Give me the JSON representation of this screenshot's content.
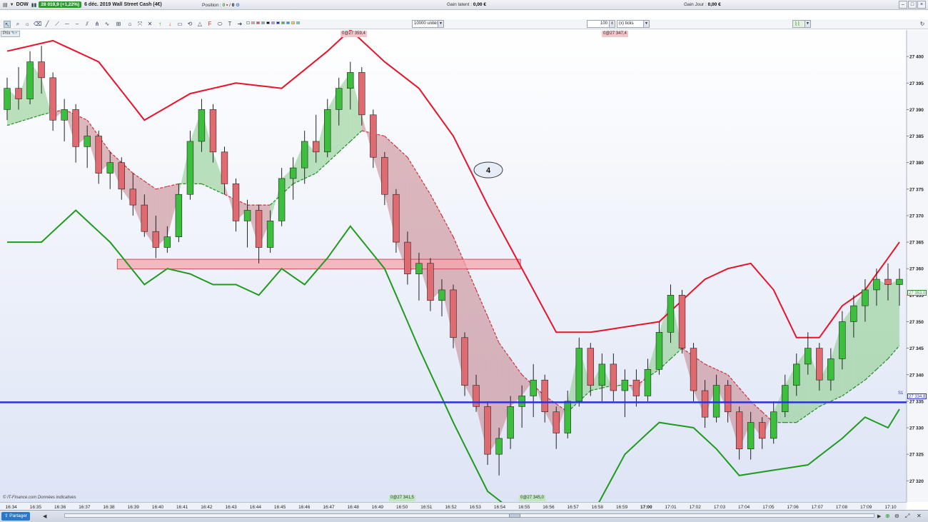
{
  "title_bar": {
    "instrument": "DOW",
    "price_badge": "28 019,9 (+1,22%)",
    "title": "6 déc. 2019 Wall Street Cash (4€)",
    "position_label": "Position :",
    "position_value": "0",
    "position_value2": "0",
    "gain_latent_label": "Gain latent :",
    "gain_latent_value": "0,00 €",
    "gain_jour_label": "Gain Jour :",
    "gain_jour_value": "0,00 €"
  },
  "toolbar": {
    "quantity_value": "10000 unités",
    "ticks_value": "100",
    "ticks_unit": "(x) ticks"
  },
  "labels": {
    "prix_tab": "Prix",
    "copyright": "© IT-Finance.com Données indicatives",
    "share_button": "Partager",
    "annotation": "4",
    "marker_top_left": "0@27 359,4",
    "marker_top_right": "0@27 347,4",
    "marker_bottom_left": "0@27 341,5",
    "marker_bottom_right": "0@27 345,0",
    "current_price": "27 353,0",
    "blue_line_price": "27 334,8",
    "blue_line_tag": "S1"
  },
  "colors": {
    "bull": "#3cbf3c",
    "bear": "#e06a70",
    "upper_band": "#e8132a",
    "lower_band": "#1f9a1f",
    "support_line": "#2832d8"
  },
  "chart_data": {
    "type": "candlestick",
    "ylim": [
      27316,
      27405
    ],
    "y_ticks": [
      27400,
      27395,
      27390,
      27385,
      27380,
      27375,
      27370,
      27365,
      27360,
      27355,
      27350,
      27345,
      27340,
      27335,
      27330,
      27325,
      27320
    ],
    "y_tick_labels": [
      "27 400",
      "27 395",
      "27 390",
      "27 385",
      "27 380",
      "27 375",
      "27 370",
      "27 365",
      "27 360",
      "27 355",
      "27 350",
      "27 345",
      "27 340",
      "27 335",
      "27 330",
      "27 325",
      "27 320"
    ],
    "x_ticks": [
      "16:34",
      "16:35",
      "16:36",
      "16:37",
      "16:38",
      "16:39",
      "16:40",
      "16:41",
      "16:42",
      "16:43",
      "16:44",
      "16:45",
      "16:46",
      "16:47",
      "16:48",
      "16:49",
      "16:50",
      "16:51",
      "16:52",
      "16:53",
      "16:54",
      "16:55",
      "16:56",
      "16:57",
      "16:58",
      "16:59",
      "17:00",
      "17:01",
      "17:02",
      "17:03",
      "17:04",
      "17:05",
      "17:06",
      "17:07",
      "17:08",
      "17:09",
      "17:10"
    ],
    "support_level": 27334.8,
    "zone": {
      "low": 27360.2,
      "high": 27361.5,
      "from": "16:38",
      "to": "16:55"
    },
    "candles": [
      [
        27390,
        27396,
        27388,
        27394
      ],
      [
        27394,
        27398,
        27390,
        27392
      ],
      [
        27392,
        27401,
        27391,
        27399
      ],
      [
        27399,
        27402,
        27393,
        27396
      ],
      [
        27396,
        27397,
        27386,
        27388
      ],
      [
        27388,
        27392,
        27384,
        27390
      ],
      [
        27390,
        27391,
        27380,
        27383
      ],
      [
        27383,
        27387,
        27379,
        27385
      ],
      [
        27385,
        27386,
        27376,
        27378
      ],
      [
        27378,
        27382,
        27375,
        27380
      ],
      [
        27380,
        27381,
        27373,
        27375
      ],
      [
        27375,
        27378,
        27370,
        27372
      ],
      [
        27372,
        27374,
        27366,
        27367
      ],
      [
        27367,
        27370,
        27362,
        27364
      ],
      [
        27364,
        27368,
        27363,
        27366
      ],
      [
        27366,
        27376,
        27365,
        27374
      ],
      [
        27374,
        27386,
        27373,
        27384
      ],
      [
        27384,
        27392,
        27382,
        27390
      ],
      [
        27390,
        27391,
        27380,
        27382
      ],
      [
        27382,
        27383,
        27374,
        27376
      ],
      [
        27376,
        27377,
        27367,
        27369
      ],
      [
        27369,
        27373,
        27364,
        27371
      ],
      [
        27371,
        27372,
        27361,
        27364
      ],
      [
        27364,
        27371,
        27363,
        27369
      ],
      [
        27369,
        27379,
        27368,
        27377
      ],
      [
        27377,
        27381,
        27373,
        27379
      ],
      [
        27379,
        27386,
        27376,
        27384
      ],
      [
        27384,
        27389,
        27380,
        27382
      ],
      [
        27382,
        27392,
        27381,
        27390
      ],
      [
        27390,
        27396,
        27387,
        27394
      ],
      [
        27394,
        27399,
        27390,
        27397
      ],
      [
        27397,
        27398,
        27387,
        27389
      ],
      [
        27389,
        27390,
        27379,
        27381
      ],
      [
        27381,
        27382,
        27372,
        27374
      ],
      [
        27374,
        27375,
        27363,
        27365
      ],
      [
        27365,
        27367,
        27357,
        27359
      ],
      [
        27359,
        27363,
        27354,
        27361
      ],
      [
        27361,
        27362,
        27352,
        27354
      ],
      [
        27354,
        27358,
        27351,
        27356
      ],
      [
        27356,
        27357,
        27345,
        27347
      ],
      [
        27347,
        27348,
        27336,
        27338
      ],
      [
        27338,
        27340,
        27333,
        27334
      ],
      [
        27334,
        27335,
        27323,
        27325
      ],
      [
        27325,
        27330,
        27321,
        27328
      ],
      [
        27328,
        27336,
        27326,
        27334
      ],
      [
        27334,
        27338,
        27330,
        27336
      ],
      [
        27336,
        27342,
        27332,
        27339
      ],
      [
        27339,
        27340,
        27331,
        27333
      ],
      [
        27333,
        27334,
        27326,
        27329
      ],
      [
        27329,
        27337,
        27328,
        27335
      ],
      [
        27335,
        27347,
        27334,
        27345
      ],
      [
        27345,
        27346,
        27336,
        27338
      ],
      [
        27338,
        27344,
        27335,
        27342
      ],
      [
        27342,
        27344,
        27335,
        27337
      ],
      [
        27337,
        27341,
        27332,
        27339
      ],
      [
        27339,
        27341,
        27334,
        27336
      ],
      [
        27336,
        27343,
        27335,
        27341
      ],
      [
        27341,
        27350,
        27340,
        27348
      ],
      [
        27348,
        27357,
        27346,
        27355
      ],
      [
        27355,
        27356,
        27344,
        27345
      ],
      [
        27345,
        27346,
        27335,
        27337
      ],
      [
        27337,
        27339,
        27330,
        27332
      ],
      [
        27332,
        27340,
        27331,
        27338
      ],
      [
        27338,
        27339,
        27331,
        27333
      ],
      [
        27333,
        27334,
        27324,
        27326
      ],
      [
        27326,
        27333,
        27324,
        27331
      ],
      [
        27331,
        27332,
        27326,
        27328
      ],
      [
        27328,
        27335,
        27327,
        27333
      ],
      [
        27333,
        27340,
        27332,
        27338
      ],
      [
        27338,
        27344,
        27336,
        27342
      ],
      [
        27342,
        27348,
        27340,
        27345
      ],
      [
        27345,
        27346,
        27337,
        27339
      ],
      [
        27339,
        27345,
        27337,
        27343
      ],
      [
        27343,
        27352,
        27341,
        27350
      ],
      [
        27350,
        27355,
        27347,
        27353
      ],
      [
        27353,
        27358,
        27350,
        27356
      ],
      [
        27356,
        27360,
        27353,
        27358
      ],
      [
        27358,
        27361,
        27354,
        27357
      ],
      [
        27357,
        27360,
        27353,
        27358
      ]
    ],
    "upper_band": [
      [
        0,
        27401
      ],
      [
        4,
        27403
      ],
      [
        8,
        27399
      ],
      [
        12,
        27388
      ],
      [
        16,
        27393
      ],
      [
        20,
        27395
      ],
      [
        24,
        27394
      ],
      [
        28,
        27401
      ],
      [
        30,
        27405
      ],
      [
        33,
        27399
      ],
      [
        36,
        27394
      ],
      [
        39,
        27385
      ],
      [
        42,
        27372
      ],
      [
        45,
        27360
      ],
      [
        48,
        27348
      ],
      [
        51,
        27348
      ],
      [
        54,
        27349
      ],
      [
        57,
        27350
      ],
      [
        59,
        27354
      ],
      [
        61,
        27358
      ],
      [
        63,
        27360
      ],
      [
        65,
        27361
      ],
      [
        67,
        27356
      ],
      [
        69,
        27347
      ],
      [
        71,
        27347
      ],
      [
        73,
        27353
      ],
      [
        75,
        27356
      ],
      [
        77,
        27362
      ],
      [
        79,
        27368
      ]
    ],
    "lower_band": [
      [
        0,
        27365
      ],
      [
        3,
        27365
      ],
      [
        6,
        27371
      ],
      [
        9,
        27365
      ],
      [
        12,
        27357
      ],
      [
        14,
        27360
      ],
      [
        16,
        27359
      ],
      [
        18,
        27357
      ],
      [
        20,
        27357
      ],
      [
        22,
        27355
      ],
      [
        24,
        27360
      ],
      [
        26,
        27357
      ],
      [
        28,
        27362
      ],
      [
        30,
        27368
      ],
      [
        33,
        27360
      ],
      [
        36,
        27345
      ],
      [
        39,
        27331
      ],
      [
        42,
        27318
      ],
      [
        45,
        27313
      ],
      [
        48,
        27310
      ],
      [
        51,
        27313
      ],
      [
        54,
        27325
      ],
      [
        57,
        27331
      ],
      [
        60,
        27330
      ],
      [
        62,
        27326
      ],
      [
        64,
        27321
      ],
      [
        67,
        27322
      ],
      [
        70,
        27323
      ],
      [
        73,
        27328
      ],
      [
        75,
        27332
      ],
      [
        77,
        27330
      ],
      [
        79,
        27337
      ]
    ],
    "mid_line": [
      [
        0,
        27387
      ],
      [
        3,
        27389
      ],
      [
        5,
        27390
      ],
      [
        7,
        27388
      ],
      [
        9,
        27382
      ],
      [
        11,
        27378
      ],
      [
        13,
        27375
      ],
      [
        15,
        27376
      ],
      [
        17,
        27376
      ],
      [
        19,
        27374
      ],
      [
        21,
        27372
      ],
      [
        23,
        27372
      ],
      [
        25,
        27376
      ],
      [
        27,
        27378
      ],
      [
        29,
        27382
      ],
      [
        31,
        27386
      ],
      [
        33,
        27385
      ],
      [
        35,
        27381
      ],
      [
        37,
        27374
      ],
      [
        39,
        27366
      ],
      [
        41,
        27356
      ],
      [
        43,
        27346
      ],
      [
        45,
        27340
      ],
      [
        47,
        27336
      ],
      [
        49,
        27333
      ],
      [
        51,
        27337
      ],
      [
        53,
        27338
      ],
      [
        55,
        27338
      ],
      [
        57,
        27341
      ],
      [
        59,
        27345
      ],
      [
        61,
        27342
      ],
      [
        63,
        27340
      ],
      [
        65,
        27335
      ],
      [
        67,
        27331
      ],
      [
        69,
        27331
      ],
      [
        71,
        27334
      ],
      [
        73,
        27336
      ],
      [
        75,
        27339
      ],
      [
        77,
        27343
      ],
      [
        79,
        27348
      ]
    ]
  }
}
